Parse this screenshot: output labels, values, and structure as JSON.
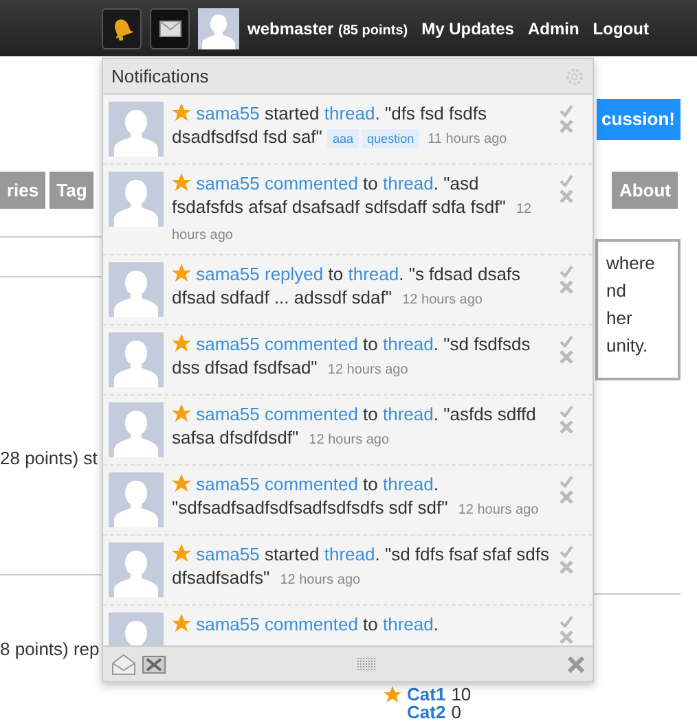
{
  "top_bar": {
    "user": "webmaster",
    "points": "(85 points)",
    "links": [
      "My Updates",
      "Admin",
      "Logout"
    ]
  },
  "page": {
    "button": "cussion!",
    "nav_tabs": [
      "ries",
      "Tag",
      "About"
    ],
    "info_lines": [
      "where",
      "nd",
      "her",
      "unity."
    ],
    "activity": [
      "28 points) st",
      "8 points) rep"
    ],
    "categories": [
      {
        "name": "Cat1",
        "count": "10",
        "starred": true
      },
      {
        "name": "Cat2",
        "count": "0",
        "starred": false
      }
    ]
  },
  "notifications": {
    "title": "Notifications",
    "items": [
      {
        "user": "sama55",
        "action": "started",
        "action_linked": false,
        "target": "thread",
        "text": ". \"dfs fsd fsdfs dsadfsdfsd fsd saf\"",
        "tags": [
          "aaa",
          "question"
        ],
        "time": "11 hours ago"
      },
      {
        "user": "sama55",
        "action": "commented",
        "action_linked": true,
        "connector": "to",
        "target": "thread",
        "text": ". \"asd fsdafsfds afsaf dsafsadf sdfsdaff sdfa fsdf\"",
        "time": "12 hours ago"
      },
      {
        "user": "sama55",
        "action": "replyed",
        "action_linked": true,
        "connector": "to",
        "target": "thread",
        "text": ". \"s fdsad dsafs dfsad sdfadf ... adssdf sdaf\"",
        "time": "12 hours ago"
      },
      {
        "user": "sama55",
        "action": "commented",
        "action_linked": true,
        "connector": "to",
        "target": "thread",
        "text": ". \"sd fsdfsds dss dfsad fsdfsad\"",
        "time": "12 hours ago"
      },
      {
        "user": "sama55",
        "action": "commented",
        "action_linked": true,
        "connector": "to",
        "target": "thread",
        "text": ". \"asfds sdffd safsa dfsdfdsdf\"",
        "time": "12 hours ago"
      },
      {
        "user": "sama55",
        "action": "commented",
        "action_linked": true,
        "connector": "to",
        "target": "thread",
        "text": ". \"sdfsadfsadfsdfsadfsdfsdfs sdf sdf\"",
        "time": "12 hours ago"
      },
      {
        "user": "sama55",
        "action": "started",
        "action_linked": false,
        "target": "thread",
        "text": ". \"sd fdfs fsaf sfaf sdfs dfsadfsadfs\"",
        "time": "12 hours ago"
      },
      {
        "user": "sama55",
        "action": "commented",
        "action_linked": true,
        "connector": "to",
        "target": "thread",
        "text": "."
      }
    ]
  }
}
